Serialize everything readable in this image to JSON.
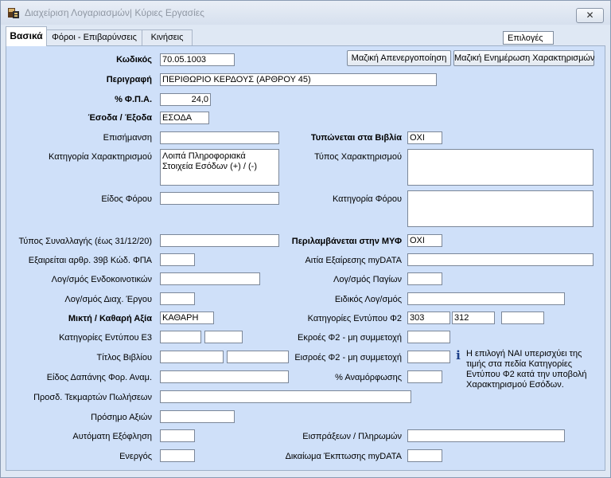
{
  "window": {
    "title": "Διαχείριση Λογαριασμών| Κύριες Εργασίες",
    "close_label": "✕"
  },
  "tabs": [
    {
      "label": "Βασικά"
    },
    {
      "label": "Φόροι - Επιβαρύνσεις"
    },
    {
      "label": "Κινήσεις"
    }
  ],
  "options_label": "Επιλογές",
  "buttons": {
    "bulk_deactivate": "Μαζική Απενεργοποίηση",
    "bulk_update": "Μαζική Ενημέρωση Χαρακτηρισμών"
  },
  "fields": {
    "code": {
      "label": "Κωδικός",
      "value": "70.05.1003"
    },
    "description": {
      "label": "Περιγραφή",
      "value": "ΠΕΡΙΘΩΡΙΟ ΚΕΡΔΟΥΣ (ΑΡΘΡΟΥ 45)"
    },
    "vat": {
      "label": "% Φ.Π.Α.",
      "value": "24,0"
    },
    "income_expense": {
      "label": "Έσοδα / Έξοδα",
      "value": "ΕΣΟΔΑ"
    },
    "notation": {
      "label": "Επισήμανση",
      "value": ""
    },
    "printed_in_books": {
      "label": "Τυπώνεται στα Βιβλία",
      "value": "ΟΧΙ"
    },
    "characterization_category": {
      "label": "Κατηγορία Χαρακτηρισμού",
      "value": "Λοιπά Πληροφοριακά Στοιχεία Εσόδων (+) / (-)"
    },
    "characterization_type": {
      "label": "Τύπος Χαρακτηρισμού",
      "value": ""
    },
    "tax_type": {
      "label": "Είδος Φόρου",
      "value": ""
    },
    "tax_category": {
      "label": "Κατηγορία Φόρου",
      "value": ""
    },
    "transaction_type": {
      "label": "Τύπος Συναλλαγής (έως 31/12/20)",
      "value": ""
    },
    "included_myf": {
      "label": "Περιλαμβάνεται στην ΜΥΦ",
      "value": "ΟΧΙ"
    },
    "exempt_39b": {
      "label": "Εξαιρείται αρθρ. 39β Κώδ. ΦΠΑ",
      "value": ""
    },
    "exemption_reason": {
      "label": "Αιτία Εξαίρεσης myDATA",
      "value": ""
    },
    "intra_community": {
      "label": "Λογ/σμός Ενδοκοινοτικών",
      "value": ""
    },
    "fixed_assets": {
      "label": "Λογ/σμός  Παγίων",
      "value": ""
    },
    "project_mgmt": {
      "label": "Λογ/σμός Διαχ. Έργου",
      "value": ""
    },
    "special_account": {
      "label": "Ειδικός Λογ/σμός",
      "value": ""
    },
    "gross_net": {
      "label": "Μικτή  / Καθαρή Αξία",
      "value": "ΚΑΘΑΡΗ"
    },
    "f2_categories": {
      "label": "Κατηγορίες Εντύπου Φ2",
      "values": [
        "303",
        "312",
        ""
      ]
    },
    "e3_categories": {
      "label": "Κατηγορίες Εντύπου Ε3",
      "values": [
        "",
        ""
      ]
    },
    "f2_outflows": {
      "label": "Εκροές Φ2 - μη συμμετοχή",
      "value": ""
    },
    "book_title": {
      "label": "Τίτλος Βιβλίου",
      "values": [
        "",
        ""
      ]
    },
    "f2_inflows": {
      "label": "Εισροές Φ2 - μη συμμετοχή",
      "value": ""
    },
    "expense_kind": {
      "label": "Είδος Δαπάνης Φορ. Αναμ.",
      "value": ""
    },
    "restructuring": {
      "label": "% Αναμόρφωσης",
      "value": ""
    },
    "sales_receipts": {
      "label": "Προσδ. Τεκμαρτών Πωλήσεων",
      "value": ""
    },
    "value_sign": {
      "label": "Πρόσημο Αξιών",
      "value": ""
    },
    "auto_settlement": {
      "label": "Αυτόματη Εξόφληση",
      "value": ""
    },
    "collections_payments": {
      "label": "Εισπράξεων / Πληρωμών",
      "value": ""
    },
    "active": {
      "label": "Ενεργός",
      "value": ""
    },
    "deduction_right": {
      "label": "Δικαίωμα Έκπτωσης myDATA",
      "value": ""
    }
  },
  "info_note": "Η επιλογή ΝΑΙ υπερισχύει της τιμής στα πεδία Κατηγορίες Εντύπου Φ2 κατά την υποβολή Χαρακτηρισμού Εσόδων."
}
